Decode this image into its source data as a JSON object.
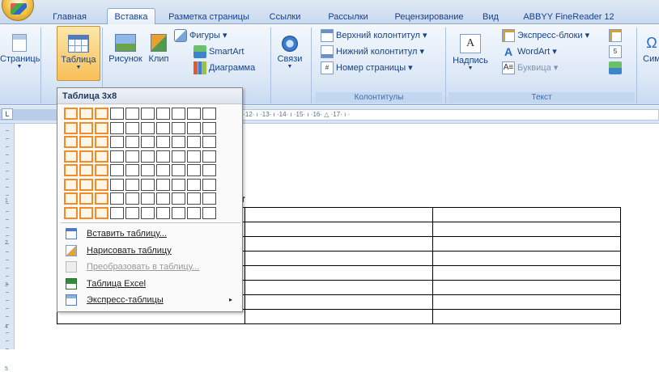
{
  "tabs": [
    "Главная",
    "Вставка",
    "Разметка страницы",
    "Ссылки",
    "Рассылки",
    "Рецензирование",
    "Вид",
    "ABBYY FineReader 12"
  ],
  "active_tab": "Вставка",
  "ribbon": {
    "pages_label": "Страницы",
    "table_label": "Таблица",
    "picture_label": "Рисунок",
    "clip_label": "Клип",
    "shapes_label": "Фигуры ▾",
    "smartart_label": "SmartArt",
    "chart_label": "Диаграмма",
    "links_label": "Связи",
    "header_label": "Верхний колонтитул ▾",
    "footer_label": "Нижний колонтитул ▾",
    "pagenum_label": "Номер страницы ▾",
    "hf_group": "Колонтитулы",
    "textbox_label": "Надпись",
    "express_label": "Экспресс-блоки ▾",
    "wordart_label": "WordArt ▾",
    "dropcap_label": "Буквица ▾",
    "text_group": "Текст",
    "symbols_label": "Сим"
  },
  "ruler": {
    "corner": "L",
    "ticks": "· 1 · ı · 2 · ı · 3 · ı · 4 · ı · 5 · ı · 6 · ı · 7 · ı · 8 · ı · 9 · ı ·10· ı ·11· ı ·12· ı ·13· ı ·14· ı ·15· ı ·16· △ ·17· ı ·"
  },
  "vruler": [
    "1",
    "2",
    "3",
    "4",
    "5"
  ],
  "doc_text": "т",
  "dropdown": {
    "title": "Таблица 3x8",
    "grid": {
      "cols": 10,
      "rows": 8,
      "selected_cols": 3,
      "selected_rows": 8
    },
    "items": [
      {
        "label": "Вставить таблицу...",
        "icon": "table-icon",
        "enabled": true,
        "submenu": false
      },
      {
        "label": "Нарисовать таблицу",
        "icon": "pencil-icon",
        "enabled": true,
        "submenu": false
      },
      {
        "label": "Преобразовать в таблицу...",
        "icon": "convert-icon",
        "enabled": false,
        "submenu": false
      },
      {
        "label": "Таблица Excel",
        "icon": "excel-icon",
        "enabled": true,
        "submenu": false
      },
      {
        "label": "Экспресс-таблицы",
        "icon": "quick-tables-icon",
        "enabled": true,
        "submenu": true
      }
    ],
    "submenu_arrow": "▸"
  },
  "colors": {
    "accent": "#f38b26",
    "ribbon": "#dbe7f6",
    "tabtext": "#15428b"
  }
}
